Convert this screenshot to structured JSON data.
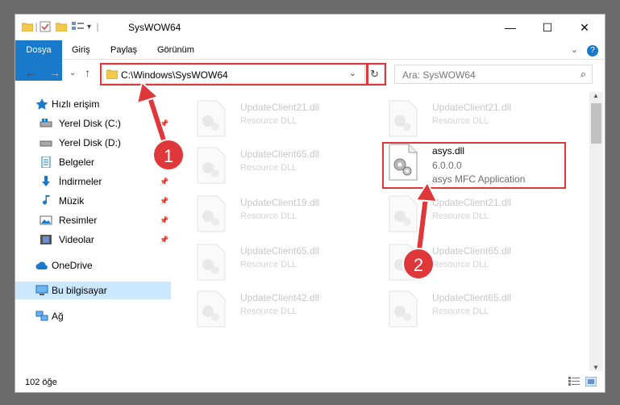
{
  "window": {
    "title": "SysWOW64"
  },
  "controls": {
    "minimize": "—",
    "maximize": "☐",
    "close": "✕"
  },
  "ribbon": {
    "tabs": [
      "Dosya",
      "Giriş",
      "Paylaş",
      "Görünüm"
    ],
    "expand": "⌄",
    "help": "?"
  },
  "nav": {
    "back": "←",
    "forward": "→",
    "recent": "⌄",
    "up": "↑"
  },
  "address": {
    "path": "C:\\Windows\\SysWOW64",
    "chevron": "⌄",
    "refresh": "↻"
  },
  "search": {
    "placeholder": "Ara: SysWOW64",
    "icon": "⌕"
  },
  "sidebar": {
    "items": [
      {
        "label": "Hızlı erişim",
        "icon": "star-icon",
        "pinned": false
      },
      {
        "label": "Yerel Disk (C:)",
        "icon": "drive-icon",
        "pinned": true
      },
      {
        "label": "Yerel Disk (D:)",
        "icon": "drive-icon",
        "pinned": true
      },
      {
        "label": "Belgeler",
        "icon": "documents-icon",
        "pinned": true
      },
      {
        "label": "İndirmeler",
        "icon": "download-icon",
        "pinned": true
      },
      {
        "label": "Müzik",
        "icon": "music-icon",
        "pinned": true
      },
      {
        "label": "Resimler",
        "icon": "pictures-icon",
        "pinned": true
      },
      {
        "label": "Videolar",
        "icon": "videos-icon",
        "pinned": true
      },
      {
        "label": "OneDrive",
        "icon": "cloud-icon",
        "pinned": false
      },
      {
        "label": "Bu bilgisayar",
        "icon": "computer-icon",
        "pinned": false
      },
      {
        "label": "Ağ",
        "icon": "network-icon",
        "pinned": false
      }
    ],
    "pin_glyph": "📌"
  },
  "files": {
    "left": [
      {
        "name": "UpdateClient21.dll",
        "desc": "Resource DLL"
      },
      {
        "name": "UpdateClient65.dll",
        "desc": "Resource DLL"
      },
      {
        "name": "UpdateClient19.dll",
        "desc": "Resource DLL"
      },
      {
        "name": "UpdateClient65.dll",
        "desc": "Resource DLL"
      },
      {
        "name": "UpdateClient42.dll",
        "desc": "Resource DLL"
      }
    ],
    "right": [
      {
        "name": "UpdateClient21.dll",
        "desc": "Resource DLL"
      },
      {
        "name": "asys.dll",
        "version": "6.0.0.0",
        "desc": "asys MFC Application"
      },
      {
        "name": "UpdateClient21.dll",
        "desc": "Resource DLL"
      },
      {
        "name": "UpdateClient65.dll",
        "desc": "Resource DLL"
      },
      {
        "name": "UpdateClient65.dll",
        "desc": "Resource DLL"
      }
    ]
  },
  "status": {
    "count": "102 öğe"
  },
  "markers": [
    "1",
    "2"
  ],
  "colors": {
    "accent": "#1979ca",
    "highlight": "#e0383a",
    "selected": "#cce8ff"
  }
}
